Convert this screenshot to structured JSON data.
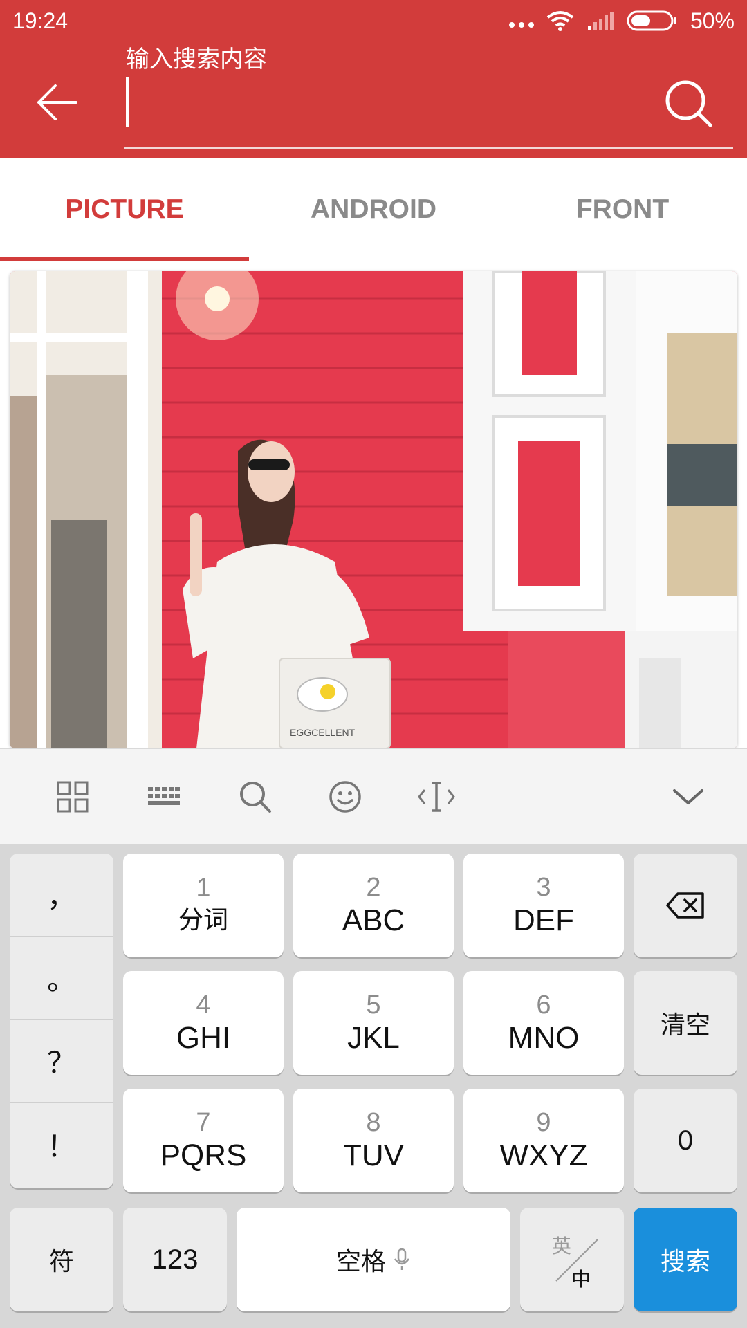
{
  "status_bar": {
    "time": "19:24",
    "battery_percent": "50%",
    "battery_level": 0.5,
    "icons": [
      "more-dots-icon",
      "wifi-icon",
      "signal-icon",
      "battery-icon"
    ]
  },
  "header": {
    "color": "#d23c3b",
    "search_hint": "输入搜索内容",
    "search_value": "",
    "back_icon": "arrow-left-icon",
    "search_icon": "search-icon"
  },
  "tabs": [
    {
      "label": "PICTURE",
      "active": true
    },
    {
      "label": "ANDROID",
      "active": false
    },
    {
      "label": "FRONT",
      "active": false
    }
  ],
  "content": {
    "card_image": "photo",
    "bag_text": "EGGCELLENT"
  },
  "keyboard": {
    "toolbar_icons": [
      "grid-icon",
      "keyboard-icon",
      "search-icon",
      "emoji-icon",
      "cursor-icon",
      "collapse-icon"
    ],
    "punctuation": [
      "，",
      "。",
      "？",
      "！"
    ],
    "keys": [
      {
        "num": "1",
        "letters": "分词"
      },
      {
        "num": "2",
        "letters": "ABC"
      },
      {
        "num": "3",
        "letters": "DEF"
      },
      {
        "num": "4",
        "letters": "GHI"
      },
      {
        "num": "5",
        "letters": "JKL"
      },
      {
        "num": "6",
        "letters": "MNO"
      },
      {
        "num": "7",
        "letters": "PQRS"
      },
      {
        "num": "8",
        "letters": "TUV"
      },
      {
        "num": "9",
        "letters": "WXYZ"
      }
    ],
    "clear_label": "清空",
    "zero_label": "0",
    "symbol_label": "符",
    "num_label": "123",
    "space_label": "空格",
    "lang_top": "英",
    "lang_bottom": "中",
    "search_label": "搜索",
    "search_key_color": "#1a8fdc"
  }
}
